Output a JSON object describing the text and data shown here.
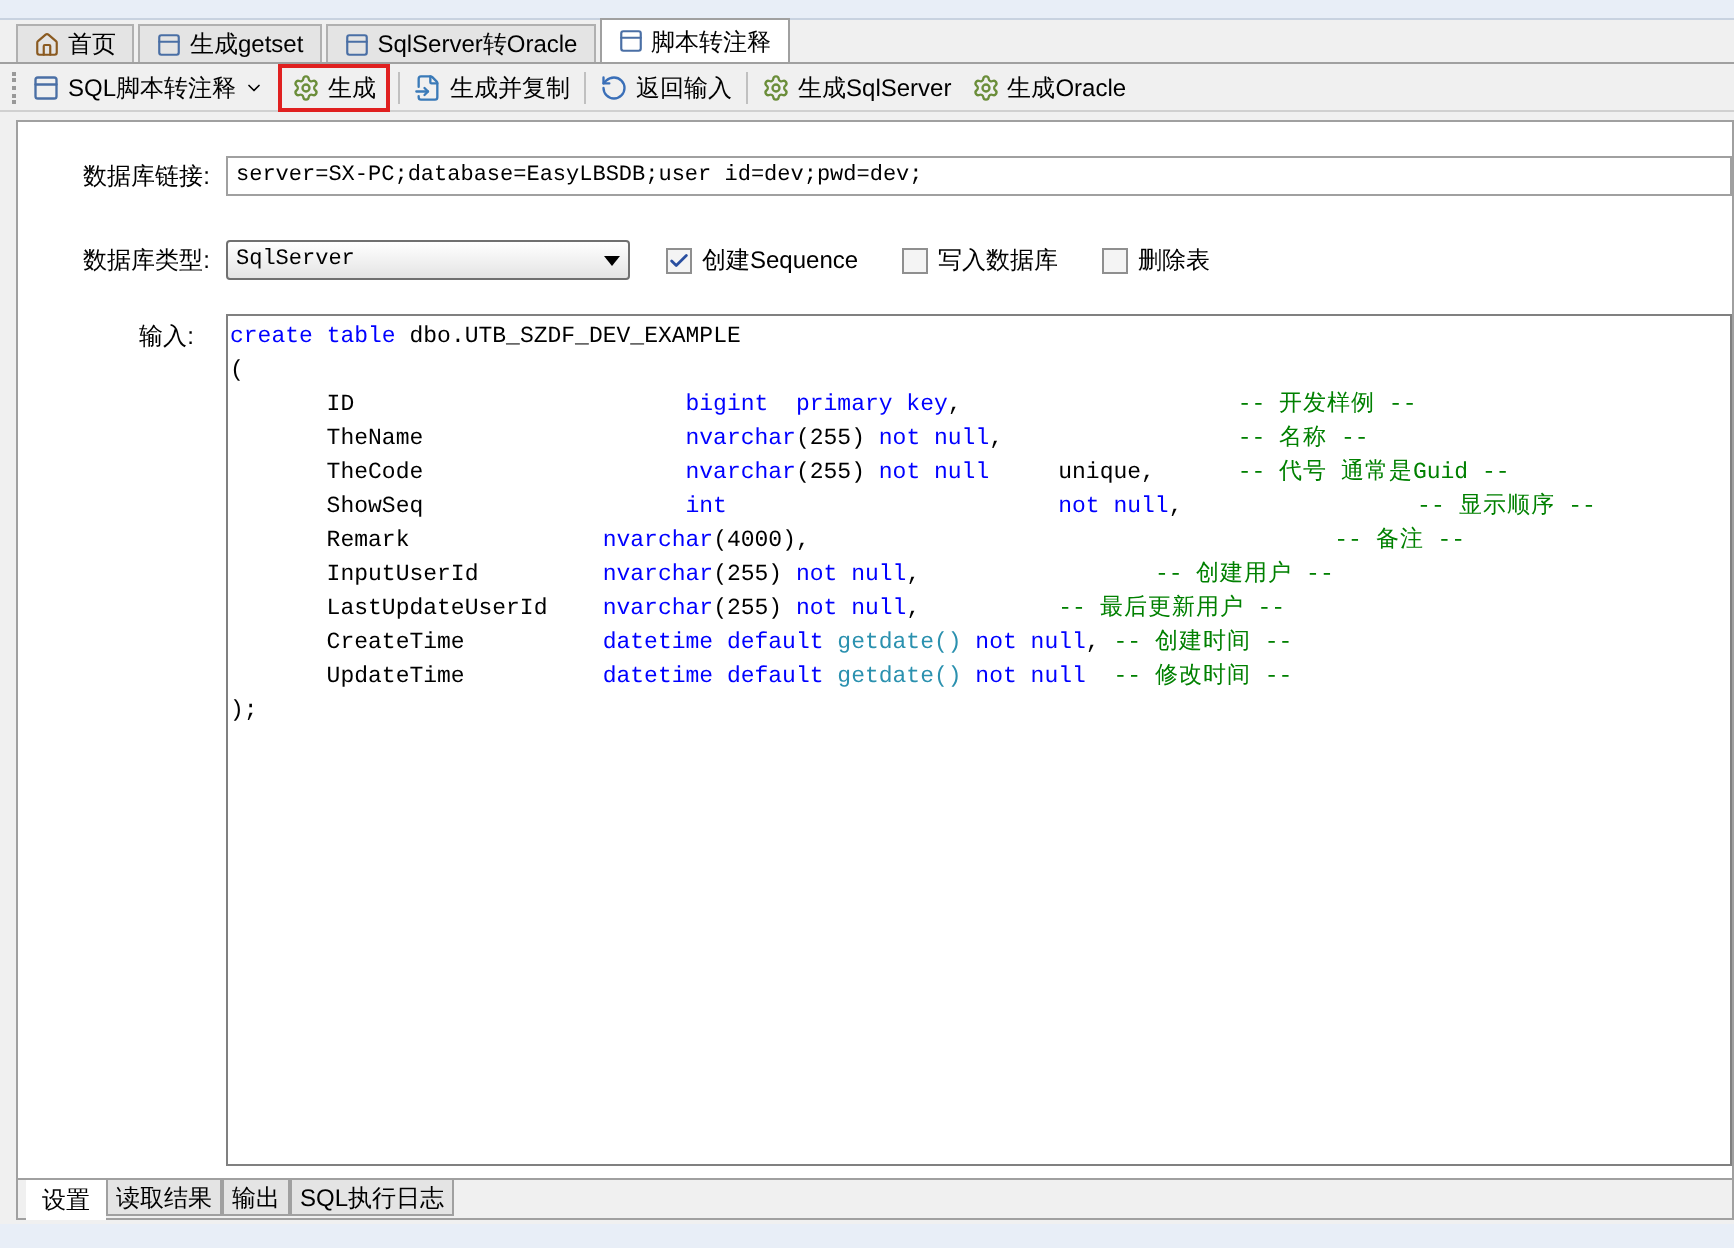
{
  "tabs": [
    {
      "label": "首页",
      "kind": "home",
      "selected": false
    },
    {
      "label": "生成getset",
      "kind": "form",
      "selected": false
    },
    {
      "label": "SqlServer转Oracle",
      "kind": "form",
      "selected": false
    },
    {
      "label": "脚本转注释",
      "kind": "form",
      "selected": true
    }
  ],
  "toolbar": [
    {
      "kind": "dropdown",
      "label": "SQL脚本转注释",
      "highlighted": false
    },
    {
      "kind": "gear",
      "label": "生成",
      "highlighted": true
    },
    {
      "kind": "copy",
      "label": "生成并复制",
      "highlighted": false
    },
    {
      "kind": "back",
      "label": "返回输入",
      "highlighted": false
    },
    {
      "kind": "gear",
      "label": "生成SqlServer",
      "highlighted": false
    },
    {
      "kind": "gear",
      "label": "生成Oracle",
      "highlighted": false
    }
  ],
  "connection": {
    "label": "数据库链接:",
    "value": "server=SX-PC;database=EasyLBSDB;user id=dev;pwd=dev;"
  },
  "db_type": {
    "label": "数据库类型:",
    "value": "SqlServer"
  },
  "options": [
    {
      "label": "创建Sequence",
      "checked": true
    },
    {
      "label": "写入数据库",
      "checked": false
    },
    {
      "label": "删除表",
      "checked": false
    }
  ],
  "input": {
    "label": "输入:",
    "lines": [
      [
        {
          "kind": "kw",
          "text": "create"
        },
        {
          "kind": "kw",
          "text": " table"
        },
        {
          "kind": "tx",
          "text": " dbo.UTB_SZDF_DEV_EXAMPLE"
        }
      ],
      [
        {
          "kind": "tx",
          "text": "("
        }
      ],
      [
        {
          "kind": "tx",
          "text": "       ID                        "
        },
        {
          "kind": "kw",
          "text": "bigint  primary key"
        },
        {
          "kind": "tx",
          "text": ",                    "
        },
        {
          "kind": "cm",
          "text": "-- 开发样例 --"
        }
      ],
      [
        {
          "kind": "tx",
          "text": "       TheName                   "
        },
        {
          "kind": "kw",
          "text": "nvarchar"
        },
        {
          "kind": "tx",
          "text": "(255) "
        },
        {
          "kind": "kw",
          "text": "not null"
        },
        {
          "kind": "tx",
          "text": ",                 "
        },
        {
          "kind": "cm",
          "text": "-- 名称 --"
        }
      ],
      [
        {
          "kind": "tx",
          "text": "       TheCode                   "
        },
        {
          "kind": "kw",
          "text": "nvarchar"
        },
        {
          "kind": "tx",
          "text": "(255) "
        },
        {
          "kind": "kw",
          "text": "not null"
        },
        {
          "kind": "tx",
          "text": "     unique,      "
        },
        {
          "kind": "cm",
          "text": "-- 代号 通常是Guid --"
        }
      ],
      [
        {
          "kind": "tx",
          "text": "       ShowSeq                   "
        },
        {
          "kind": "kw",
          "text": "int"
        },
        {
          "kind": "kw",
          "text": "                        not null"
        },
        {
          "kind": "tx",
          "text": ",                 "
        },
        {
          "kind": "cm",
          "text": "-- 显示顺序 --"
        }
      ],
      [
        {
          "kind": "tx",
          "text": "       Remark              "
        },
        {
          "kind": "kw",
          "text": "nvarchar"
        },
        {
          "kind": "tx",
          "text": "(4000),                                      "
        },
        {
          "kind": "cm",
          "text": "-- 备注 --"
        }
      ],
      [
        {
          "kind": "tx",
          "text": "       InputUserId         "
        },
        {
          "kind": "kw",
          "text": "nvarchar"
        },
        {
          "kind": "tx",
          "text": "(255) "
        },
        {
          "kind": "kw",
          "text": "not null"
        },
        {
          "kind": "tx",
          "text": ",                 "
        },
        {
          "kind": "cm",
          "text": "-- 创建用户 --"
        }
      ],
      [
        {
          "kind": "tx",
          "text": "       LastUpdateUserId    "
        },
        {
          "kind": "kw",
          "text": "nvarchar"
        },
        {
          "kind": "tx",
          "text": "(255) "
        },
        {
          "kind": "kw",
          "text": "not null"
        },
        {
          "kind": "tx",
          "text": ",          "
        },
        {
          "kind": "cm",
          "text": "-- 最后更新用户 --"
        }
      ],
      [
        {
          "kind": "tx",
          "text": "       CreateTime          "
        },
        {
          "kind": "kw",
          "text": "datetime default"
        },
        {
          "kind": "fn",
          "text": " getdate()"
        },
        {
          "kind": "kw",
          "text": " not null"
        },
        {
          "kind": "tx",
          "text": ", "
        },
        {
          "kind": "cm",
          "text": "-- 创建时间 --"
        }
      ],
      [
        {
          "kind": "tx",
          "text": "       UpdateTime          "
        },
        {
          "kind": "kw",
          "text": "datetime default"
        },
        {
          "kind": "fn",
          "text": " getdate()"
        },
        {
          "kind": "kw",
          "text": " not null"
        },
        {
          "kind": "cm",
          "text": "  -- 修改时间 --"
        }
      ],
      [
        {
          "kind": "tx",
          "text": ");"
        }
      ]
    ]
  },
  "bottom_tabs": [
    {
      "label": "设置",
      "selected": true
    },
    {
      "label": "读取结果",
      "selected": false
    },
    {
      "label": "输出",
      "selected": false
    },
    {
      "label": "SQL执行日志",
      "selected": false
    }
  ]
}
